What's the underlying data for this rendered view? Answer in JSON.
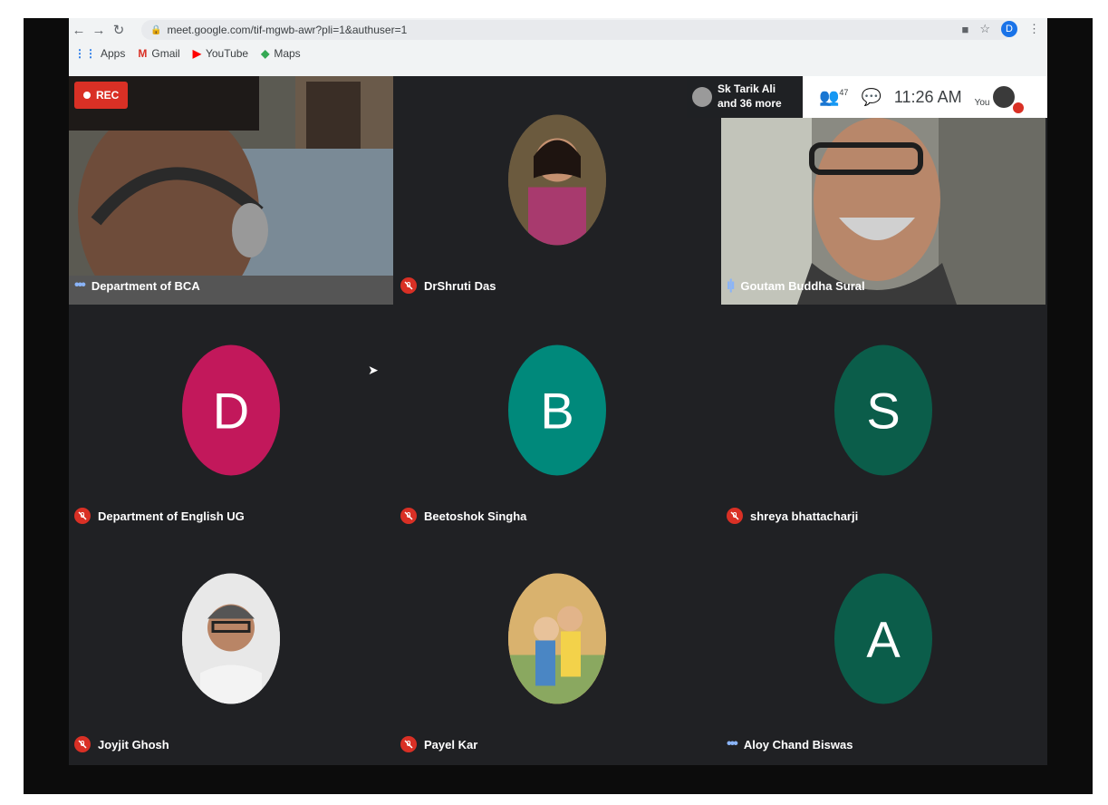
{
  "browser": {
    "url": "meet.google.com/tif-mgwb-awr?pli=1&authuser=1",
    "profile_initial": "D",
    "bookmarks": [
      {
        "label": "Apps"
      },
      {
        "label": "Gmail"
      },
      {
        "label": "YouTube"
      },
      {
        "label": "Maps"
      }
    ]
  },
  "meet": {
    "rec_label": "REC",
    "presenter_line1": "Sk Tarik Ali",
    "presenter_line2": "and 36 more",
    "people_count": "47",
    "clock": "11:26 AM",
    "you_label": "You",
    "tiles": [
      {
        "name": "Department of BCA",
        "kind": "video",
        "status": "speaking"
      },
      {
        "name": "DrShruti Das",
        "kind": "photo",
        "status": "muted"
      },
      {
        "name": "Goutam Buddha Sural",
        "kind": "video",
        "status": "speaking"
      },
      {
        "name": "Department of English UG",
        "kind": "letter",
        "letter": "D",
        "color": "#c2185b",
        "status": "muted"
      },
      {
        "name": "Beetoshok Singha",
        "kind": "letter",
        "letter": "B",
        "color": "#00897b",
        "status": "muted"
      },
      {
        "name": "shreya bhattacharji",
        "kind": "letter",
        "letter": "S",
        "color": "#0b5d4a",
        "status": "muted"
      },
      {
        "name": "Joyjit Ghosh",
        "kind": "photo",
        "status": "muted"
      },
      {
        "name": "Payel Kar",
        "kind": "photo",
        "status": "muted"
      },
      {
        "name": "Aloy Chand Biswas",
        "kind": "letter",
        "letter": "A",
        "color": "#0b5d4a",
        "status": "speaking"
      }
    ]
  },
  "colors": {
    "mic_off": "#d93025",
    "meet_bg": "#202124",
    "rec": "#d93025"
  }
}
